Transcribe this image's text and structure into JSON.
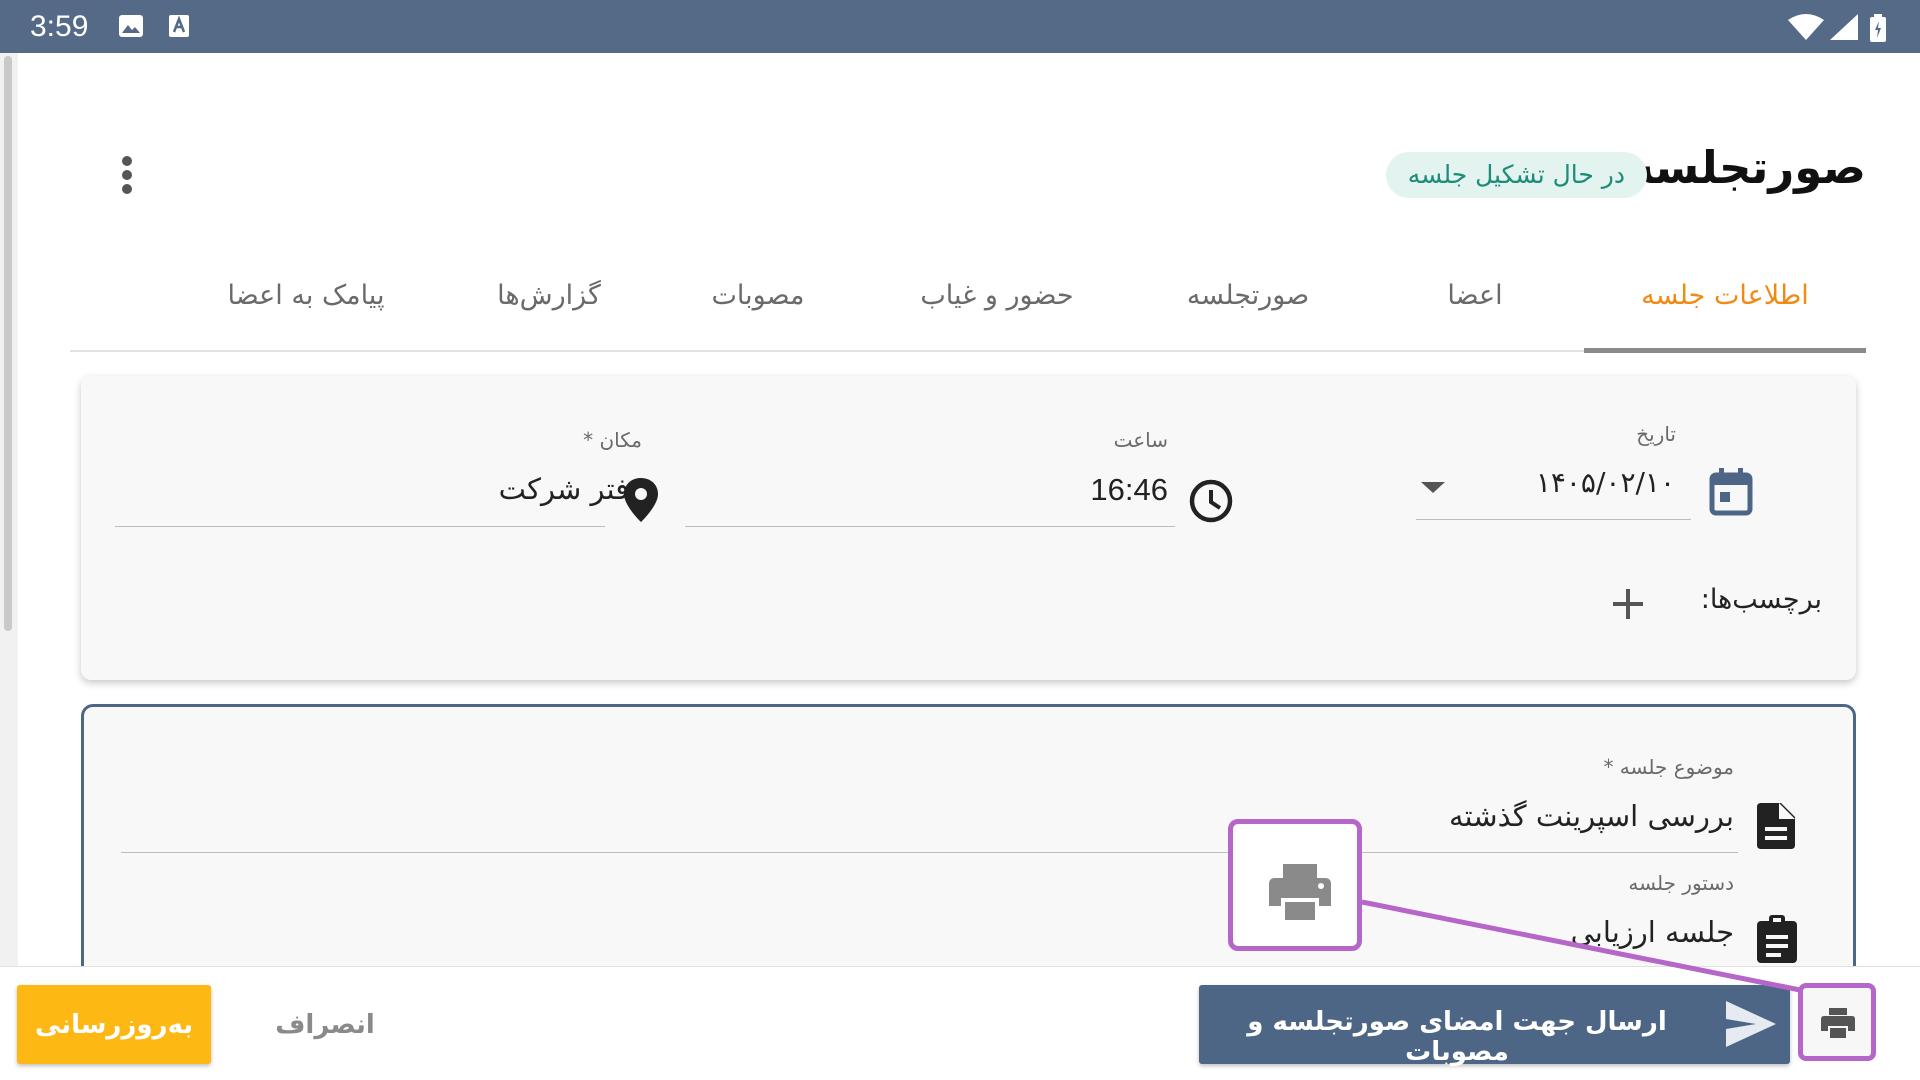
{
  "status_bar": {
    "time": "3:59"
  },
  "header": {
    "title": "صورتجلسه",
    "status_chip": "در حال تشکیل جلسه"
  },
  "tabs": [
    {
      "label": "اطلاعات جلسه",
      "active": true
    },
    {
      "label": "اعضا"
    },
    {
      "label": "صورتجلسه"
    },
    {
      "label": "حضور و غیاب"
    },
    {
      "label": "مصوبات"
    },
    {
      "label": "گزارش‌ها"
    },
    {
      "label": "پیامک به اعضا"
    }
  ],
  "meeting_info": {
    "date": {
      "label": "تاریخ",
      "value": "۱۴۰۵/۰۲/۱۰"
    },
    "time": {
      "label": "ساعت",
      "value": "16:46"
    },
    "location": {
      "label": "مکان *",
      "value": "دفتر شرکت"
    },
    "tags_label": "برچسب‌ها:"
  },
  "meeting_details": {
    "subject": {
      "label": "موضوع جلسه *",
      "value": "بررسی اسپرینت گذشته"
    },
    "agenda": {
      "label": "دستور جلسه",
      "value": "جلسه ارزیابی"
    }
  },
  "actions": {
    "update_label": "به‌روزرسانی",
    "cancel_label": "انصراف",
    "send_label": "ارسال جهت امضای صورتجلسه و مصوبات"
  },
  "colors": {
    "status_bar": "#546a86",
    "accent_orange": "#f08a14",
    "primary_blue": "#4d6685",
    "update_yellow": "#fdb813",
    "chip_green": "#1d8c78",
    "highlight_purple": "#b666c8"
  },
  "icons": [
    "image-icon",
    "keyboard-a-icon",
    "wifi-icon",
    "signal-icon",
    "battery-icon",
    "more-vert-icon",
    "calendar-icon",
    "dropdown-arrow-icon",
    "clock-icon",
    "location-pin-icon",
    "plus-icon",
    "document-icon",
    "clipboard-icon",
    "send-icon",
    "printer-icon"
  ]
}
